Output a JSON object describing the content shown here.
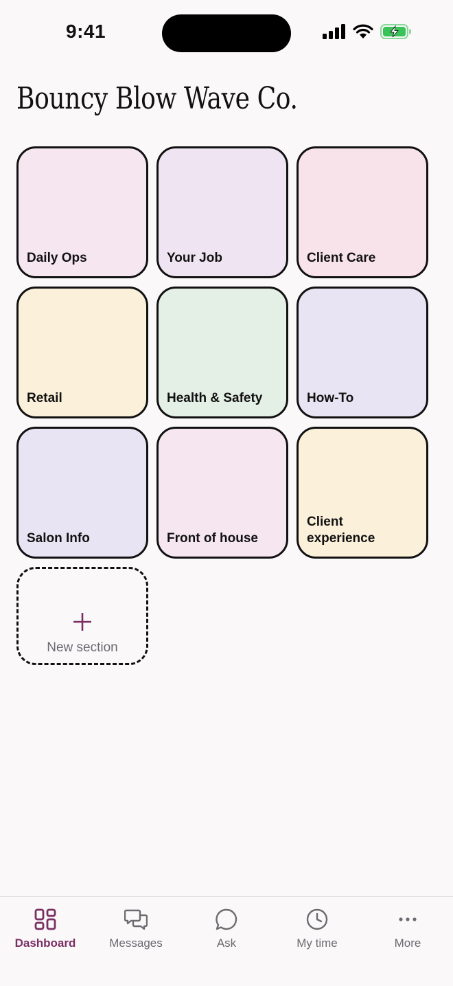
{
  "status_bar": {
    "time": "9:41"
  },
  "header": {
    "title": "Bouncy Blow Wave Co."
  },
  "sections": [
    {
      "label": "Daily Ops",
      "color": "#f6e6f0"
    },
    {
      "label": "Your Job",
      "color": "#efe4f1"
    },
    {
      "label": "Client Care",
      "color": "#f8e3ea"
    },
    {
      "label": "Retail",
      "color": "#fbf1da"
    },
    {
      "label": "Health & Safety",
      "color": "#e4efe5"
    },
    {
      "label": "How-To",
      "color": "#e9e4f3"
    },
    {
      "label": "Salon Info",
      "color": "#e9e4f3"
    },
    {
      "label": "Front of house",
      "color": "#f6e6f0"
    },
    {
      "label": "Client experience",
      "color": "#fbf0da"
    }
  ],
  "new_section": {
    "label": "New section",
    "icon": "plus-icon"
  },
  "tab_bar": {
    "tabs": [
      {
        "label": "Dashboard",
        "icon": "grid-icon",
        "active": true
      },
      {
        "label": "Messages",
        "icon": "chat-bubbles-icon",
        "active": false
      },
      {
        "label": "Ask",
        "icon": "speech-bubble-icon",
        "active": false
      },
      {
        "label": "My time",
        "icon": "clock-icon",
        "active": false
      },
      {
        "label": "More",
        "icon": "more-dots-icon",
        "active": false
      }
    ]
  },
  "colors": {
    "accent": "#7a2f63",
    "background": "#faf8f9",
    "border": "#111111",
    "battery": "#3ac35a"
  }
}
